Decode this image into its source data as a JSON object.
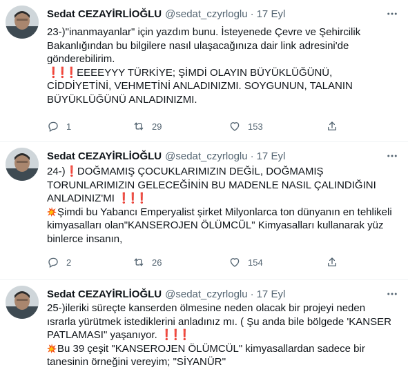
{
  "tweets": [
    {
      "name": "Sedat CEZAYİRLİOĞLU",
      "handle": "@sedat_czyrloglu",
      "dot": "·",
      "date": "17 Eyl",
      "lines": [
        "23-)\"inanmayanlar\" için yazdım bunu. İsteyenede Çevre ve Şehircilik",
        "Bakanlığından bu bilgilere nasıl ulaşacağınıza dair link adresini'de",
        "gönderebilirim.",
        "EEEEYYY TÜRKİYE; ŞİMDİ OLAYIN BÜYÜKLÜĞÜNÜ,",
        "CİDDİYETİNİ, VEHMETİNİ ANLADINIZMI. SOYGUNUN, TALANIN",
        "BÜYÜKLÜĞÜNÜ ANLADINIZMI."
      ],
      "replies": "1",
      "retweets": "29",
      "likes": "153"
    },
    {
      "name": "Sedat CEZAYİRLİOĞLU",
      "handle": "@sedat_czyrloglu",
      "dot": "·",
      "date": "17 Eyl",
      "lines": [
        "24-)",
        "DOĞMAMIŞ ÇOCUKLARIMIZIN DEĞİL, DOĞMAMIŞ",
        "TORUNLARIMIZIN GELECEĞİNİN BU MADENLE NASIL ÇALINDIĞINI",
        "ANLADINIZ'MI",
        "Şimdi bu Yabancı Emperyalist şirket Milyonlarca ton dünyanın en tehlikeli",
        "kimyasalları olan\"KANSEROJEN ÖLÜMCÜL\" Kimyasalları kullanarak yüz",
        "binlerce insanın,"
      ],
      "replies": "2",
      "retweets": "26",
      "likes": "154"
    },
    {
      "name": "Sedat CEZAYİRLİOĞLU",
      "handle": "@sedat_czyrloglu",
      "dot": "·",
      "date": "17 Eyl",
      "lines": [
        "25-)ileriki süreçte kanserden ölmesine neden olacak bir projeyi neden",
        "ısrarla yürütmek istediklerini anladınız mı. ( Şu anda bile bölgede 'KANSER",
        "PATLAMASI\" yaşanıyor.",
        "Bu 39 çeşit \"KANSEROJEN ÖLÜMCÜL\" kimyasallardan sadece bir",
        "tanesinin örneğini vereyim; \"SİYANÜR''"
      ]
    }
  ],
  "icons": {
    "more": "more-horizontal-icon",
    "reply": "reply-icon",
    "retweet": "retweet-icon",
    "like": "heart-icon",
    "share": "share-icon",
    "exclamation": "red-exclamation-emoji",
    "collision": "collision-emoji"
  },
  "colors": {
    "text": "#0f1419",
    "secondary": "#536471",
    "divider": "#eff3f4",
    "exclamation": "#e0162b"
  }
}
